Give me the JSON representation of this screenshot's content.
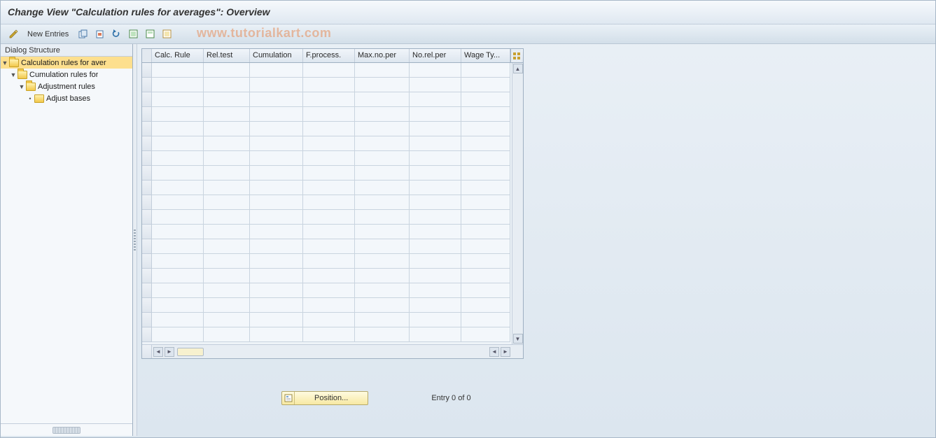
{
  "title": "Change View \"Calculation rules for averages\": Overview",
  "watermark": "www.tutorialkart.com",
  "toolbar": {
    "new_entries": "New Entries"
  },
  "tree": {
    "header": "Dialog Structure",
    "items": [
      {
        "label": "Calculation rules for aver",
        "level": 0,
        "expandable": true,
        "open": true,
        "selected": true
      },
      {
        "label": "Cumulation rules for",
        "level": 1,
        "expandable": true,
        "open": true,
        "selected": false
      },
      {
        "label": "Adjustment rules",
        "level": 2,
        "expandable": true,
        "open": true,
        "selected": false
      },
      {
        "label": "Adjust bases",
        "level": 3,
        "expandable": false,
        "open": false,
        "selected": false
      }
    ]
  },
  "table": {
    "columns": [
      "Calc. Rule",
      "Rel.test",
      "Cumulation",
      "F.process.",
      "Max.no.per",
      "No.rel.per",
      "Wage Ty..."
    ],
    "row_count": 19
  },
  "footer": {
    "position_label": "Position...",
    "entry_text": "Entry 0 of 0"
  }
}
